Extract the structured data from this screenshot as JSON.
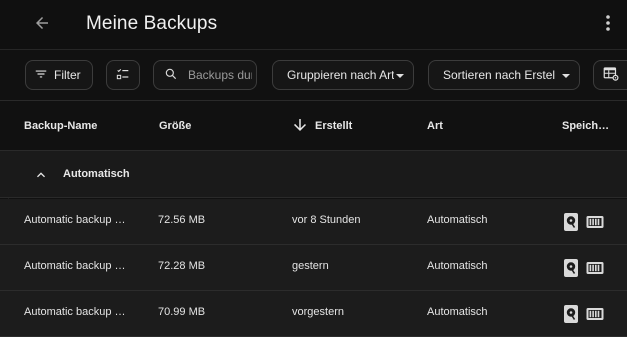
{
  "header": {
    "title": "Meine Backups"
  },
  "toolbar": {
    "filter_label": "Filter",
    "search_placeholder": "Backups durchsuchen",
    "group_label": "Gruppieren nach Art",
    "sort_label": "Sortieren nach Erstellt"
  },
  "table": {
    "columns": [
      "Backup-Name",
      "Größe",
      "Erstellt",
      "Art",
      "Speich…"
    ],
    "groups": [
      {
        "label": "Automatisch",
        "rows": [
          {
            "name": "Automatic backup …",
            "size": "72.56 MB",
            "created": "vor 8 Stunden",
            "type": "Automatisch",
            "locations": [
              "hard-drive-icon",
              "nas-storage-icon"
            ]
          },
          {
            "name": "Automatic backup …",
            "size": "72.28 MB",
            "created": "gestern",
            "type": "Automatisch",
            "locations": [
              "hard-drive-icon",
              "nas-storage-icon"
            ]
          },
          {
            "name": "Automatic backup …",
            "size": "70.99 MB",
            "created": "vorgestern",
            "type": "Automatisch",
            "locations": [
              "hard-drive-icon",
              "nas-storage-icon"
            ]
          }
        ]
      }
    ]
  },
  "colors": {
    "background": "#111111",
    "row": "#1c1c1c",
    "group_row": "#1a1a1a",
    "text": "#e4e4e4",
    "border": "#2a2a2a"
  }
}
